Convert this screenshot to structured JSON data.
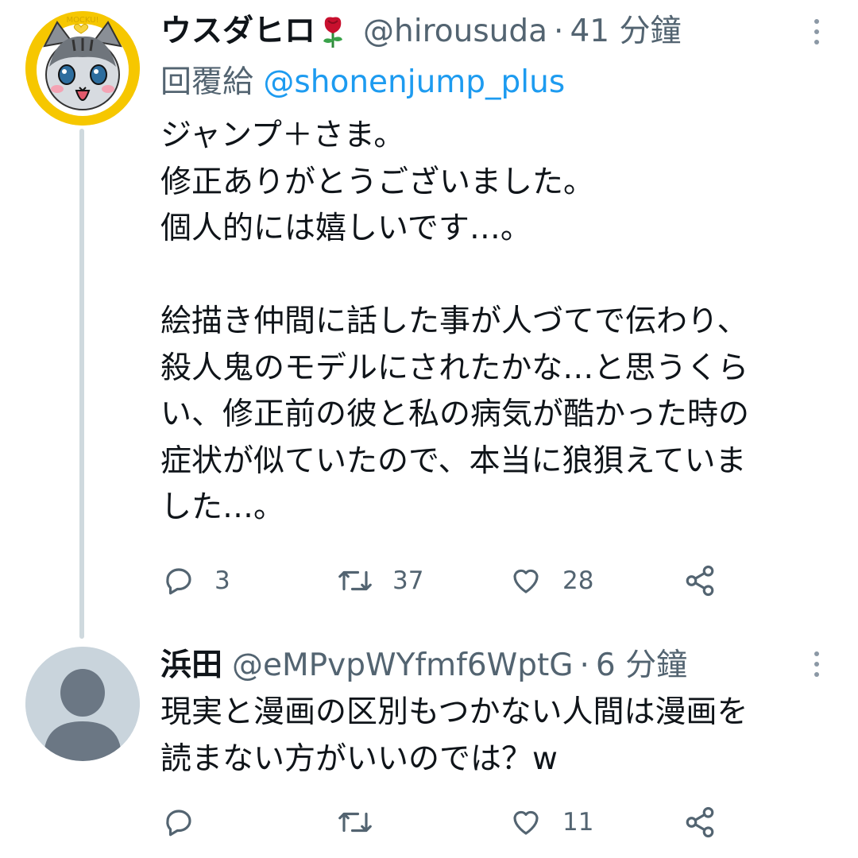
{
  "tweets": [
    {
      "display_name": "ウスダヒロ",
      "name_emoji": "rose-icon",
      "handle": "@hirousuda",
      "separator": "·",
      "time": "41 分鐘",
      "reply_label": "回覆給",
      "reply_mention": "@shonenjump_plus",
      "avatar": "cat-avatar",
      "avatar_text": "MOCKU!",
      "body_lines": [
        "ジャンプ＋さま。",
        "修正ありがとうございました。",
        "個人的には嬉しいです…。",
        "",
        "絵描き仲間に話した事が人づてで伝わり、",
        "殺人鬼のモデルにされたかな…と思うくら",
        "い、修正前の彼と私の病気が酷かった時の",
        "症状が似ていたので、本当に狼狽えていま",
        "した…。"
      ],
      "actions": {
        "reply_count": "3",
        "retweet_count": "37",
        "like_count": "28",
        "share_icon": "share-icon"
      }
    },
    {
      "display_name": "浜田",
      "handle": "@eMPvpWYfmf6WptG",
      "separator": "·",
      "time": "6 分鐘",
      "avatar": "default-avatar",
      "body_lines": [
        "現実と漫画の区別もつかない人間は漫画を",
        "読まない方がいいのでは？w"
      ],
      "actions": {
        "reply_count": "",
        "retweet_count": "",
        "like_count": "11",
        "share_icon": "share-icon"
      }
    }
  ],
  "colors": {
    "primary_text": "#0f1419",
    "secondary_text": "#536471",
    "link": "#1d9bf0",
    "thread_line": "#cfd9de",
    "avatar_yellow": "#f6c700",
    "default_avatar_bg": "#c9d4dc",
    "default_avatar_fg": "#6b7784"
  }
}
